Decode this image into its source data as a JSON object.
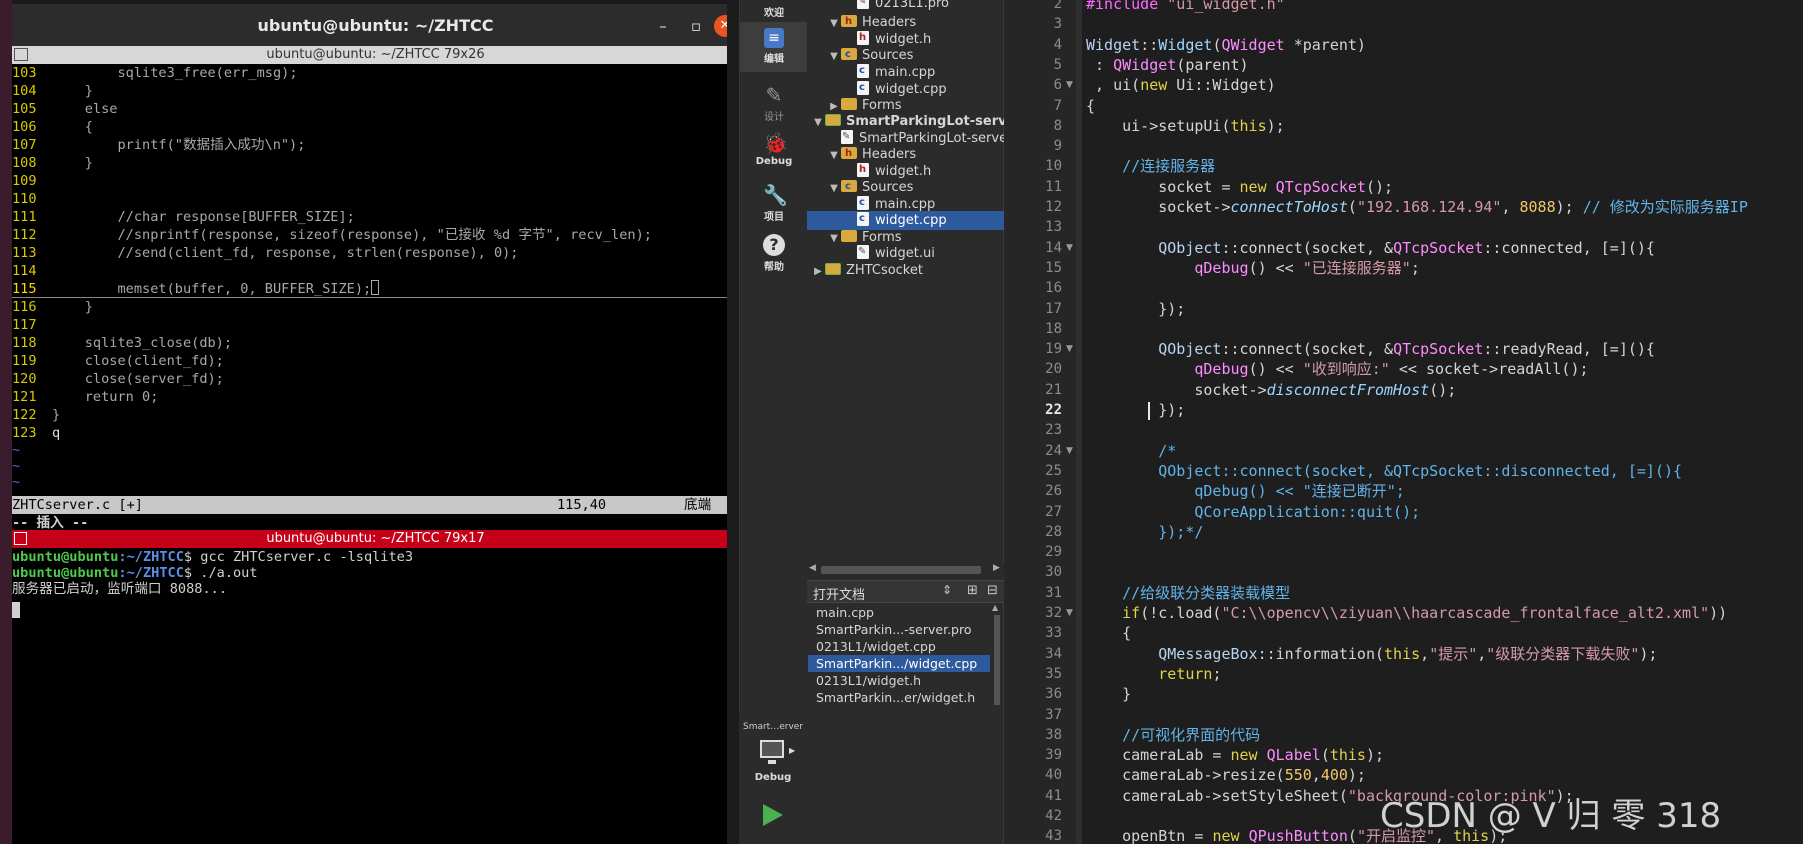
{
  "terminal": {
    "window_title": "ubuntu@ubuntu: ~/ZHTCC",
    "vim_pane_title": "ubuntu@ubuntu: ~/ZHTCC 79x26",
    "shell_pane_title": "ubuntu@ubuntu: ~/ZHTCC 79x17",
    "vim_lines": [
      {
        "n": "103",
        "t": "        sqlite3_free(err_msg);"
      },
      {
        "n": "104",
        "t": "    }"
      },
      {
        "n": "105",
        "t": "    else"
      },
      {
        "n": "106",
        "t": "    {"
      },
      {
        "n": "107",
        "t": "        printf(\"数据插入成功\\n\");"
      },
      {
        "n": "108",
        "t": "    }"
      },
      {
        "n": "109",
        "t": ""
      },
      {
        "n": "110",
        "t": ""
      },
      {
        "n": "111",
        "t": "        //char response[BUFFER_SIZE];"
      },
      {
        "n": "112",
        "t": "        //snprintf(response, sizeof(response), \"已接收 %d 字节\", recv_len);"
      },
      {
        "n": "113",
        "t": "        //send(client_fd, response, strlen(response), 0);"
      },
      {
        "n": "114",
        "t": ""
      },
      {
        "n": "115",
        "t": "        memset(buffer, 0, BUFFER_SIZE);"
      },
      {
        "n": "116",
        "t": "    }"
      },
      {
        "n": "117",
        "t": ""
      },
      {
        "n": "118",
        "t": "    sqlite3_close(db);"
      },
      {
        "n": "119",
        "t": "    close(client_fd);"
      },
      {
        "n": "120",
        "t": "    close(server_fd);"
      },
      {
        "n": "121",
        "t": "    return 0;"
      },
      {
        "n": "122",
        "t": "}"
      },
      {
        "n": "123",
        "t": "q"
      }
    ],
    "tildes": [
      "~",
      "~",
      "~"
    ],
    "vim_status": {
      "file": "ZHTCserver.c [+]",
      "pos": "115,40",
      "where": "底端"
    },
    "vim_mode": "-- 插入 --",
    "shell_lines": [
      {
        "user": "ubuntu@ubuntu",
        "path": ":~/ZHTCC",
        "cmd": "$ gcc ZHTCserver.c -lsqlite3"
      },
      {
        "user": "ubuntu@ubuntu",
        "path": ":~/ZHTCC",
        "cmd": "$ ./a.out"
      },
      {
        "user": "",
        "path": "",
        "cmd": "服务器已启动，监听端口 8088..."
      }
    ]
  },
  "qt": {
    "modes": [
      {
        "icon": "pencil-doc-icon",
        "label": "编辑"
      },
      {
        "icon": "design-pen-icon",
        "label": "设计"
      },
      {
        "icon": "bug-icon",
        "label": "Debug"
      },
      {
        "icon": "wrench-icon",
        "label": "项目"
      },
      {
        "icon": "help-icon",
        "label": "帮助"
      }
    ],
    "top_partial_mode_label": "欢迎",
    "project_tree": [
      {
        "label": "0213L1.pro",
        "kind": "file-u",
        "depth": 2,
        "arrow": ""
      },
      {
        "label": "Headers",
        "kind": "folder-h",
        "depth": 1,
        "arrow": "▼"
      },
      {
        "label": "widget.h",
        "kind": "file-h",
        "depth": 2,
        "arrow": ""
      },
      {
        "label": "Sources",
        "kind": "folder-c",
        "depth": 1,
        "arrow": "▼"
      },
      {
        "label": "main.cpp",
        "kind": "file-c",
        "depth": 2,
        "arrow": ""
      },
      {
        "label": "widget.cpp",
        "kind": "file-c",
        "depth": 2,
        "arrow": ""
      },
      {
        "label": "Forms",
        "kind": "folder",
        "depth": 1,
        "arrow": "▶"
      },
      {
        "label": "SmartParkingLot-server",
        "kind": "project",
        "depth": 0,
        "arrow": "▼"
      },
      {
        "label": "SmartParkingLot-server.pro",
        "kind": "file-u",
        "depth": 1,
        "arrow": ""
      },
      {
        "label": "Headers",
        "kind": "folder-h",
        "depth": 1,
        "arrow": "▼"
      },
      {
        "label": "widget.h",
        "kind": "file-h",
        "depth": 2,
        "arrow": ""
      },
      {
        "label": "Sources",
        "kind": "folder-c",
        "depth": 1,
        "arrow": "▼"
      },
      {
        "label": "main.cpp",
        "kind": "file-c",
        "depth": 2,
        "arrow": ""
      },
      {
        "label": "widget.cpp",
        "kind": "file-c",
        "depth": 2,
        "arrow": "",
        "selected": true
      },
      {
        "label": "Forms",
        "kind": "folder",
        "depth": 1,
        "arrow": "▼"
      },
      {
        "label": "widget.ui",
        "kind": "file-ui",
        "depth": 2,
        "arrow": ""
      },
      {
        "label": "ZHTCsocket",
        "kind": "project",
        "depth": 0,
        "arrow": "▶"
      }
    ],
    "open_docs_label": "打开文档",
    "open_docs": [
      {
        "label": "main.cpp"
      },
      {
        "label": "SmartParkin...-server.pro"
      },
      {
        "label": "0213L1/widget.cpp"
      },
      {
        "label": "SmartParkin.../widget.cpp",
        "selected": true
      },
      {
        "label": "0213L1/widget.h"
      },
      {
        "label": "SmartParkin...er/widget.h"
      }
    ],
    "kit_label": "Smart…erver",
    "run_mode_label": "Debug",
    "current_line": "22",
    "line_numbers": [
      "2",
      "3",
      "4",
      "5",
      "6",
      "7",
      "8",
      "9",
      "10",
      "11",
      "12",
      "13",
      "14",
      "15",
      "16",
      "17",
      "18",
      "19",
      "20",
      "21",
      "22",
      "23",
      "24",
      "25",
      "26",
      "27",
      "28",
      "29",
      "30",
      "31",
      "32",
      "33",
      "34",
      "35",
      "36",
      "37",
      "38",
      "39",
      "40",
      "41",
      "42",
      "43"
    ],
    "code_lines": [
      [
        [
          "pp",
          "#include "
        ],
        [
          "st",
          "\"ui_widget.h\""
        ]
      ],
      [],
      [
        [
          "sc",
          "Widget"
        ],
        [
          "",
          "::"
        ],
        [
          "fn",
          "Widget"
        ],
        [
          "",
          "("
        ],
        [
          "ty",
          "QWidget"
        ],
        [
          "",
          " *parent)"
        ]
      ],
      [
        [
          "",
          " : "
        ],
        [
          "ty",
          "QWidget"
        ],
        [
          "",
          "(parent)"
        ]
      ],
      [
        [
          "",
          " , ui("
        ],
        [
          "k",
          "new"
        ],
        [
          "",
          " Ui::Widget)"
        ]
      ],
      [
        [
          "",
          "{"
        ]
      ],
      [
        [
          "",
          "    ui->setupUi("
        ],
        [
          "k",
          "this"
        ],
        [
          "",
          ");"
        ]
      ],
      [],
      [
        [
          "cm",
          "    //连接服务器"
        ]
      ],
      [
        [
          "",
          "        socket = "
        ],
        [
          "k",
          "new"
        ],
        [
          "",
          " "
        ],
        [
          "ty",
          "QTcpSocket"
        ],
        [
          "",
          "();"
        ]
      ],
      [
        [
          "",
          "        socket->"
        ],
        [
          "it",
          "connectToHost"
        ],
        [
          "",
          "("
        ],
        [
          "st",
          "\"192.168.124.94\""
        ],
        [
          ", ",
          ", "
        ],
        [
          "num",
          "8088"
        ],
        [
          "",
          "); "
        ],
        [
          "cm",
          "// 修改为实际服务器IP"
        ]
      ],
      [],
      [
        [
          "",
          "        "
        ],
        [
          "sc",
          "QObject"
        ],
        [
          "",
          "::connect(socket, &"
        ],
        [
          "ty",
          "QTcpSocket"
        ],
        [
          "",
          "::connected, [=](){"
        ]
      ],
      [
        [
          "",
          "            "
        ],
        [
          "ty",
          "qDebug"
        ],
        [
          "",
          "() << "
        ],
        [
          "st",
          "\"已连接服务器\""
        ],
        [
          "",
          ";"
        ]
      ],
      [],
      [
        [
          "",
          "        });"
        ]
      ],
      [],
      [
        [
          "",
          "        "
        ],
        [
          "sc",
          "QObject"
        ],
        [
          "",
          "::connect(socket, &"
        ],
        [
          "ty",
          "QTcpSocket"
        ],
        [
          "",
          "::readyRead, [=](){"
        ]
      ],
      [
        [
          "",
          "            "
        ],
        [
          "ty",
          "qDebug"
        ],
        [
          "",
          "() << "
        ],
        [
          "st",
          "\"收到响应:\""
        ],
        [
          "",
          " << socket->readAll();"
        ]
      ],
      [
        [
          "",
          "            socket->"
        ],
        [
          "it",
          "disconnectFromHost"
        ],
        [
          "",
          "();"
        ]
      ],
      [
        [
          "",
          "        });"
        ]
      ],
      [],
      [
        [
          "cm",
          "        /*"
        ]
      ],
      [
        [
          "cm",
          "        QObject::connect(socket, &QTcpSocket::disconnected, [=](){"
        ]
      ],
      [
        [
          "cm",
          "            qDebug() << \"连接已断开\";"
        ]
      ],
      [
        [
          "cm",
          "            QCoreApplication::quit();"
        ]
      ],
      [
        [
          "cm",
          "        });*/"
        ]
      ],
      [],
      [],
      [
        [
          "cm",
          "    //给级联分类器装载模型"
        ]
      ],
      [
        [
          "k",
          "    if"
        ],
        [
          "",
          "(!c.load("
        ],
        [
          "st",
          "\"C:\\\\opencv\\\\ziyuan\\\\haarcascade_frontalface_alt2.xml\""
        ],
        [
          "",
          "))"
        ]
      ],
      [
        [
          "",
          "    {"
        ]
      ],
      [
        [
          "",
          "        "
        ],
        [
          "sc",
          "QMessageBox"
        ],
        [
          "",
          "::information("
        ],
        [
          "k",
          "this"
        ],
        [
          "",
          ","
        ],
        [
          "st",
          "\"提示\""
        ],
        [
          "",
          ","
        ],
        [
          "st",
          "\"级联分类器下载失败\""
        ],
        [
          "",
          ");"
        ]
      ],
      [
        [
          "k",
          "        return"
        ],
        [
          "",
          ";"
        ]
      ],
      [
        [
          "",
          "    }"
        ]
      ],
      [],
      [
        [
          "cm",
          "    //可视化界面的代码"
        ]
      ],
      [
        [
          "",
          "    cameraLab = "
        ],
        [
          "k",
          "new"
        ],
        [
          "",
          " "
        ],
        [
          "ty",
          "QLabel"
        ],
        [
          "",
          "("
        ],
        [
          "k",
          "this"
        ],
        [
          "",
          ");"
        ]
      ],
      [
        [
          "",
          "    cameraLab->resize("
        ],
        [
          "num",
          "550"
        ],
        [
          "",
          ","
        ],
        [
          "num",
          "400"
        ],
        [
          "",
          ");"
        ]
      ],
      [
        [
          "",
          "    cameraLab->setStyleSheet("
        ],
        [
          "st",
          "\"background-color:pink\""
        ],
        [
          "",
          ");"
        ]
      ],
      [],
      [
        [
          "",
          "    openBtn = "
        ],
        [
          "k",
          "new"
        ],
        [
          "",
          " "
        ],
        [
          "ty",
          "QPushButton"
        ],
        [
          "",
          "("
        ],
        [
          "st",
          "\"开启监控\""
        ],
        [
          "",
          ", "
        ],
        [
          "k",
          "this"
        ],
        [
          "",
          ");"
        ]
      ]
    ],
    "watermark": "CSDN @ V 归 零 318"
  }
}
